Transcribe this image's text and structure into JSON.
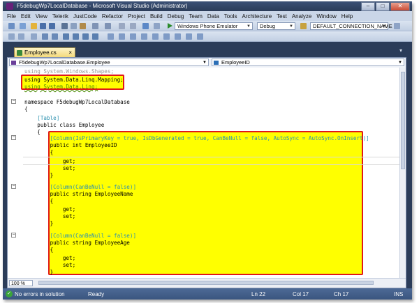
{
  "window": {
    "title": "F5debugWp7LocalDatabase - Microsoft Visual Studio (Administrator)",
    "minimize": "–",
    "maximize": "□",
    "close": "✕"
  },
  "menu": [
    "File",
    "Edit",
    "View",
    "Telerik",
    "JustCode",
    "Refactor",
    "Project",
    "Build",
    "Debug",
    "Team",
    "Data",
    "Tools",
    "Architecture",
    "Test",
    "Analyze",
    "Window",
    "Help"
  ],
  "toolbar": {
    "target": "Windows Phone Emulator",
    "configuration": "Debug",
    "connection": "DEFAULT_CONNECTION_NAME"
  },
  "tabs": [
    {
      "label": "Employee.cs",
      "close": "×"
    }
  ],
  "tab_overflow": "▾",
  "nav": {
    "type_dropdown": "F5debugWp7LocalDatabase.Employee",
    "member_dropdown": "EmployeeID"
  },
  "code_lines": [
    "using System.Windows.Shapes;",
    "using System.Data.Linq.Mapping;",
    "using System.Data.Linq;",
    "",
    "namespace F5debugWp7LocalDatabase",
    "{",
    "    [Table]",
    "    public class Employee",
    "    {",
    "        [Column(IsPrimaryKey = true, IsDbGenerated = true, CanBeNull = false, AutoSync = AutoSync.OnInsert)]",
    "        public int EmployeeID",
    "        {",
    "",
    "            get;",
    "            set;",
    "        }",
    "",
    "        [Column(CanBeNull = false)]",
    "        public string EmployeeName",
    "        {",
    "            get;",
    "            set;",
    "        }",
    "",
    "        [Column(CanBeNull = false)]",
    "        public string EmployeeAge",
    "        {",
    "            get;",
    "            set;",
    "        }"
  ],
  "zoom": "100 %",
  "status": {
    "message": "No errors in solution",
    "state": "Ready",
    "line": "Ln 22",
    "column": "Col 17",
    "char": "Ch 17",
    "mode": "INS"
  },
  "colors": {
    "highlight": "#ffff00",
    "annotation_border": "#e11818",
    "keyword": "#0000ff",
    "type": "#2b91af"
  }
}
